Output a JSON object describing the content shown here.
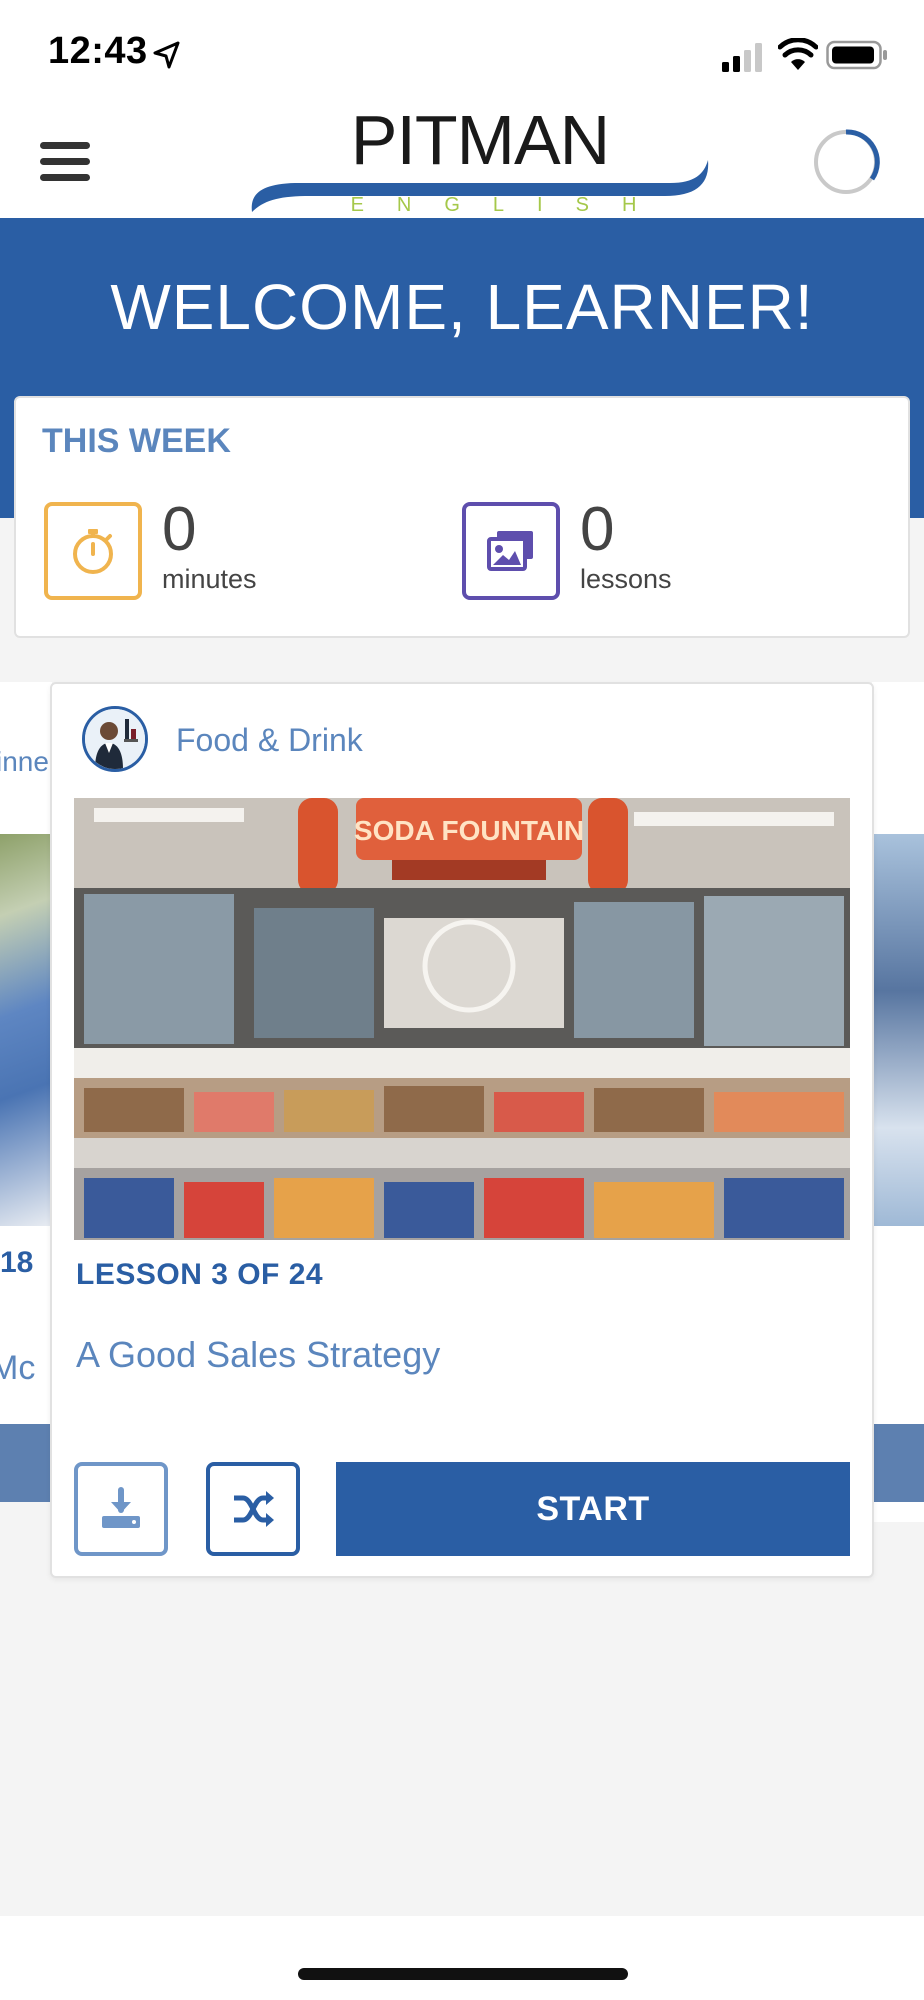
{
  "status_bar": {
    "time": "12:43",
    "icons": [
      "location-arrow-icon",
      "cellular-signal-icon",
      "wifi-icon",
      "battery-icon"
    ]
  },
  "header": {
    "menu_icon": "hamburger-menu-icon",
    "logo_title": "PITMAN",
    "logo_subtitle": "ENGLISH",
    "progress_icon": "progress-ring-icon"
  },
  "welcome": {
    "title": "WELCOME, LEARNER!"
  },
  "this_week": {
    "heading": "THIS WEEK",
    "stats": [
      {
        "value": "0",
        "label": "minutes",
        "icon": "stopwatch-icon",
        "color": "#f0b44e"
      },
      {
        "value": "0",
        "label": "lessons",
        "icon": "images-icon",
        "color": "#5e4ead"
      }
    ]
  },
  "carousel_peek_left": {
    "label": "inne",
    "number": "18",
    "subtitle": "- Mc"
  },
  "lesson_card": {
    "category": "Food & Drink",
    "category_icon": "waiter-avatar-icon",
    "lesson_count": "LESSON 3 OF 24",
    "title": "A Good Sales Strategy",
    "image_sign": "SODA FOUNTAIN",
    "buttons": {
      "download_icon": "download-icon",
      "shuffle_icon": "shuffle-icon",
      "start_label": "START"
    }
  },
  "colors": {
    "brand_blue": "#2a5ea4",
    "light_blue": "#5b86bd",
    "accent_green": "#a5c84a",
    "orange": "#f0b44e",
    "purple": "#5e4ead"
  }
}
